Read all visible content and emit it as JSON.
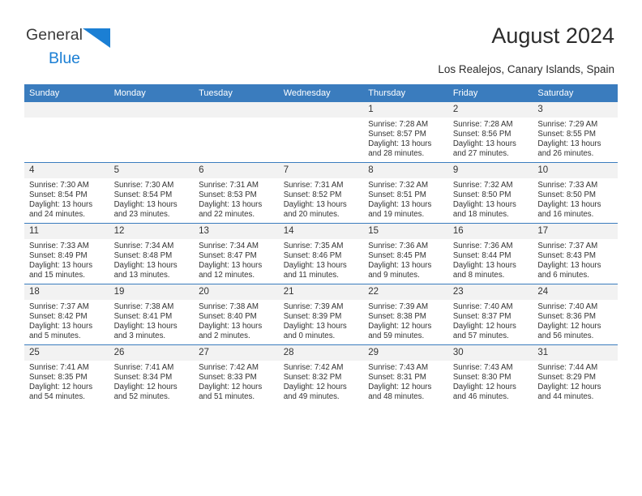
{
  "brand": {
    "name_part1": "General",
    "name_part2": "Blue",
    "logo_icon": "triangle-logo-icon",
    "accent_color": "#1b7fd4"
  },
  "header": {
    "title": "August 2024",
    "subtitle": "Los Realejos, Canary Islands, Spain"
  },
  "calendar": {
    "header_bg": "#3a7cbe",
    "daynum_bg": "#f2f2f2",
    "weekdays": [
      "Sunday",
      "Monday",
      "Tuesday",
      "Wednesday",
      "Thursday",
      "Friday",
      "Saturday"
    ],
    "weeks": [
      [
        {
          "day": "",
          "empty": true
        },
        {
          "day": "",
          "empty": true
        },
        {
          "day": "",
          "empty": true
        },
        {
          "day": "",
          "empty": true
        },
        {
          "day": "1",
          "sunrise": "Sunrise: 7:28 AM",
          "sunset": "Sunset: 8:57 PM",
          "daylight1": "Daylight: 13 hours",
          "daylight2": "and 28 minutes."
        },
        {
          "day": "2",
          "sunrise": "Sunrise: 7:28 AM",
          "sunset": "Sunset: 8:56 PM",
          "daylight1": "Daylight: 13 hours",
          "daylight2": "and 27 minutes."
        },
        {
          "day": "3",
          "sunrise": "Sunrise: 7:29 AM",
          "sunset": "Sunset: 8:55 PM",
          "daylight1": "Daylight: 13 hours",
          "daylight2": "and 26 minutes."
        }
      ],
      [
        {
          "day": "4",
          "sunrise": "Sunrise: 7:30 AM",
          "sunset": "Sunset: 8:54 PM",
          "daylight1": "Daylight: 13 hours",
          "daylight2": "and 24 minutes."
        },
        {
          "day": "5",
          "sunrise": "Sunrise: 7:30 AM",
          "sunset": "Sunset: 8:54 PM",
          "daylight1": "Daylight: 13 hours",
          "daylight2": "and 23 minutes."
        },
        {
          "day": "6",
          "sunrise": "Sunrise: 7:31 AM",
          "sunset": "Sunset: 8:53 PM",
          "daylight1": "Daylight: 13 hours",
          "daylight2": "and 22 minutes."
        },
        {
          "day": "7",
          "sunrise": "Sunrise: 7:31 AM",
          "sunset": "Sunset: 8:52 PM",
          "daylight1": "Daylight: 13 hours",
          "daylight2": "and 20 minutes."
        },
        {
          "day": "8",
          "sunrise": "Sunrise: 7:32 AM",
          "sunset": "Sunset: 8:51 PM",
          "daylight1": "Daylight: 13 hours",
          "daylight2": "and 19 minutes."
        },
        {
          "day": "9",
          "sunrise": "Sunrise: 7:32 AM",
          "sunset": "Sunset: 8:50 PM",
          "daylight1": "Daylight: 13 hours",
          "daylight2": "and 18 minutes."
        },
        {
          "day": "10",
          "sunrise": "Sunrise: 7:33 AM",
          "sunset": "Sunset: 8:50 PM",
          "daylight1": "Daylight: 13 hours",
          "daylight2": "and 16 minutes."
        }
      ],
      [
        {
          "day": "11",
          "sunrise": "Sunrise: 7:33 AM",
          "sunset": "Sunset: 8:49 PM",
          "daylight1": "Daylight: 13 hours",
          "daylight2": "and 15 minutes."
        },
        {
          "day": "12",
          "sunrise": "Sunrise: 7:34 AM",
          "sunset": "Sunset: 8:48 PM",
          "daylight1": "Daylight: 13 hours",
          "daylight2": "and 13 minutes."
        },
        {
          "day": "13",
          "sunrise": "Sunrise: 7:34 AM",
          "sunset": "Sunset: 8:47 PM",
          "daylight1": "Daylight: 13 hours",
          "daylight2": "and 12 minutes."
        },
        {
          "day": "14",
          "sunrise": "Sunrise: 7:35 AM",
          "sunset": "Sunset: 8:46 PM",
          "daylight1": "Daylight: 13 hours",
          "daylight2": "and 11 minutes."
        },
        {
          "day": "15",
          "sunrise": "Sunrise: 7:36 AM",
          "sunset": "Sunset: 8:45 PM",
          "daylight1": "Daylight: 13 hours",
          "daylight2": "and 9 minutes."
        },
        {
          "day": "16",
          "sunrise": "Sunrise: 7:36 AM",
          "sunset": "Sunset: 8:44 PM",
          "daylight1": "Daylight: 13 hours",
          "daylight2": "and 8 minutes."
        },
        {
          "day": "17",
          "sunrise": "Sunrise: 7:37 AM",
          "sunset": "Sunset: 8:43 PM",
          "daylight1": "Daylight: 13 hours",
          "daylight2": "and 6 minutes."
        }
      ],
      [
        {
          "day": "18",
          "sunrise": "Sunrise: 7:37 AM",
          "sunset": "Sunset: 8:42 PM",
          "daylight1": "Daylight: 13 hours",
          "daylight2": "and 5 minutes."
        },
        {
          "day": "19",
          "sunrise": "Sunrise: 7:38 AM",
          "sunset": "Sunset: 8:41 PM",
          "daylight1": "Daylight: 13 hours",
          "daylight2": "and 3 minutes."
        },
        {
          "day": "20",
          "sunrise": "Sunrise: 7:38 AM",
          "sunset": "Sunset: 8:40 PM",
          "daylight1": "Daylight: 13 hours",
          "daylight2": "and 2 minutes."
        },
        {
          "day": "21",
          "sunrise": "Sunrise: 7:39 AM",
          "sunset": "Sunset: 8:39 PM",
          "daylight1": "Daylight: 13 hours",
          "daylight2": "and 0 minutes."
        },
        {
          "day": "22",
          "sunrise": "Sunrise: 7:39 AM",
          "sunset": "Sunset: 8:38 PM",
          "daylight1": "Daylight: 12 hours",
          "daylight2": "and 59 minutes."
        },
        {
          "day": "23",
          "sunrise": "Sunrise: 7:40 AM",
          "sunset": "Sunset: 8:37 PM",
          "daylight1": "Daylight: 12 hours",
          "daylight2": "and 57 minutes."
        },
        {
          "day": "24",
          "sunrise": "Sunrise: 7:40 AM",
          "sunset": "Sunset: 8:36 PM",
          "daylight1": "Daylight: 12 hours",
          "daylight2": "and 56 minutes."
        }
      ],
      [
        {
          "day": "25",
          "sunrise": "Sunrise: 7:41 AM",
          "sunset": "Sunset: 8:35 PM",
          "daylight1": "Daylight: 12 hours",
          "daylight2": "and 54 minutes."
        },
        {
          "day": "26",
          "sunrise": "Sunrise: 7:41 AM",
          "sunset": "Sunset: 8:34 PM",
          "daylight1": "Daylight: 12 hours",
          "daylight2": "and 52 minutes."
        },
        {
          "day": "27",
          "sunrise": "Sunrise: 7:42 AM",
          "sunset": "Sunset: 8:33 PM",
          "daylight1": "Daylight: 12 hours",
          "daylight2": "and 51 minutes."
        },
        {
          "day": "28",
          "sunrise": "Sunrise: 7:42 AM",
          "sunset": "Sunset: 8:32 PM",
          "daylight1": "Daylight: 12 hours",
          "daylight2": "and 49 minutes."
        },
        {
          "day": "29",
          "sunrise": "Sunrise: 7:43 AM",
          "sunset": "Sunset: 8:31 PM",
          "daylight1": "Daylight: 12 hours",
          "daylight2": "and 48 minutes."
        },
        {
          "day": "30",
          "sunrise": "Sunrise: 7:43 AM",
          "sunset": "Sunset: 8:30 PM",
          "daylight1": "Daylight: 12 hours",
          "daylight2": "and 46 minutes."
        },
        {
          "day": "31",
          "sunrise": "Sunrise: 7:44 AM",
          "sunset": "Sunset: 8:29 PM",
          "daylight1": "Daylight: 12 hours",
          "daylight2": "and 44 minutes."
        }
      ]
    ]
  }
}
